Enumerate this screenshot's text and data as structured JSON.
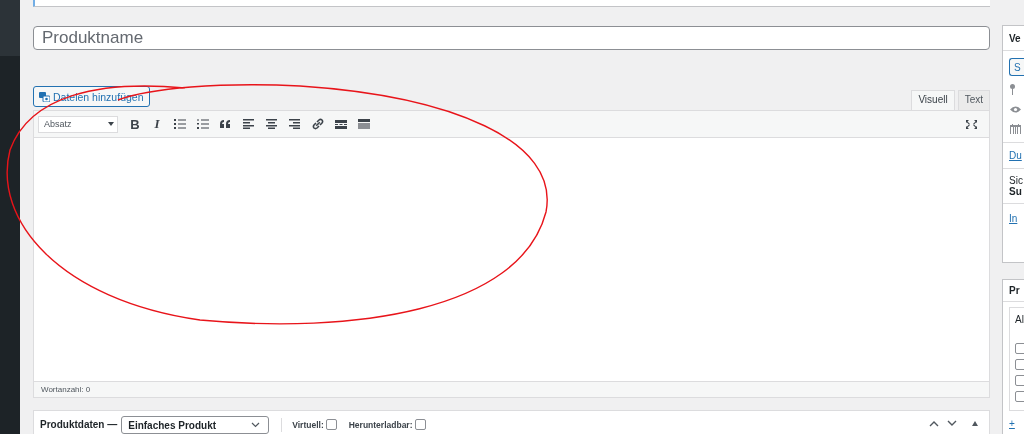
{
  "title_field": {
    "placeholder": "Produktname"
  },
  "editor": {
    "add_media": "Dateien hinzufügen",
    "tabs": [
      {
        "label": "Visuell",
        "selected": true
      },
      {
        "label": "Text",
        "selected": false
      }
    ],
    "format_select": "Absatz",
    "text_buttons": [
      {
        "kind": "bold",
        "label": "B"
      },
      {
        "kind": "italic",
        "label": "I"
      }
    ],
    "word_count": "Wortanzahl: 0"
  },
  "product_data": {
    "title": "Produktdaten —",
    "type_select": "Einfaches Produkt",
    "options": [
      {
        "label": "Virtuell:",
        "checked": false
      },
      {
        "label": "Herunterladbar:",
        "checked": false
      }
    ]
  },
  "sidebar": {
    "publish_box": {
      "title": "Ve",
      "button": "S",
      "link_1": "Du",
      "text_1": "Sic",
      "text_2": "Su",
      "link_2": "In"
    },
    "category_box": {
      "title": "Pr",
      "tab": "Al",
      "checkboxes": [
        {
          "checked": false
        },
        {
          "checked": false
        },
        {
          "checked": false
        },
        {
          "checked": false
        }
      ],
      "link": "+"
    }
  }
}
